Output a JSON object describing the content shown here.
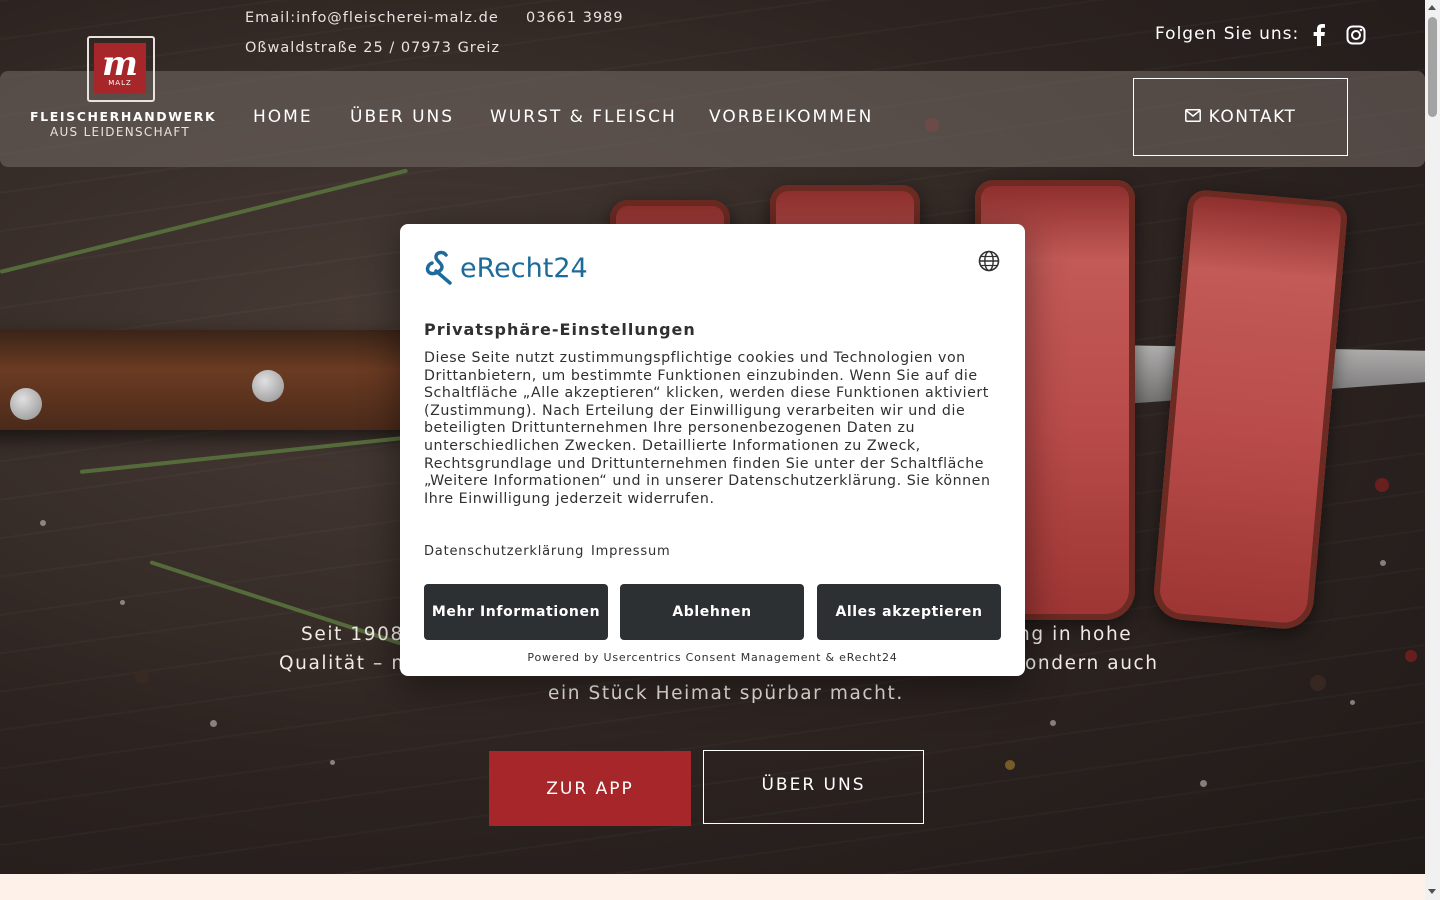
{
  "topbar": {
    "email": "Email:info@fleischerei-malz.de",
    "phone": "03661 3989",
    "address": "Oßwaldstraße 25 / 07973 Greiz",
    "follow_label": "Folgen Sie uns:",
    "social_icons": [
      "facebook-icon",
      "instagram-icon"
    ]
  },
  "logo": {
    "mark": "m",
    "mark_sub": "MALZ",
    "line1": "FLEISCHERHANDWERK",
    "line2": "AUS LEIDENSCHAFT",
    "brand_color": "#a7262a"
  },
  "nav": {
    "items": [
      "HOME",
      "ÜBER UNS",
      "WURST & FLEISCH",
      "VORBEIKOMMEN"
    ],
    "contact_label": "KONTAKT",
    "contact_icon": "envelope-icon"
  },
  "hero": {
    "line1_left": "Seit 1908",
    "line1_right": "ng in hohe",
    "line2_left": "Qualität – m",
    "line2_right": "ondern auch",
    "line3": "ein Stück Heimat spürbar macht.",
    "btn_app": "ZUR APP",
    "btn_about": "ÜBER UNS"
  },
  "consent": {
    "brand": "eRecht24",
    "language_icon": "globe-icon",
    "title": "Privatsphäre-Einstellungen",
    "body": "Diese Seite nutzt zustimmungspflichtige cookies und Technologien von Drittanbietern, um bestimmte Funktionen einzubinden. Wenn Sie auf die Schaltfläche „Alle akzeptieren“ klicken, werden diese Funktionen aktiviert (Zustimmung). Nach Erteilung der Einwilligung verarbeiten wir und die beteiligten Drittunternehmen Ihre personenbezogenen Daten zu unterschiedlichen Zwecken. Detaillierte Informationen zu Zweck, Rechtsgrundlage und Drittunternehmen finden Sie unter der Schaltfläche „Weitere Informationen“ und in unserer Datenschutzerklärung. Sie können Ihre Einwilligung jederzeit widerrufen.",
    "link_privacy": "Datenschutzerklärung",
    "link_imprint": "Impressum",
    "btn_more": "Mehr Informationen",
    "btn_decline": "Ablehnen",
    "btn_accept": "Alles akzeptieren",
    "powered_by": "Powered by Usercentrics Consent Management & eRecht24",
    "button_color": "#2d3033",
    "brand_color": "#1c6b9a"
  }
}
